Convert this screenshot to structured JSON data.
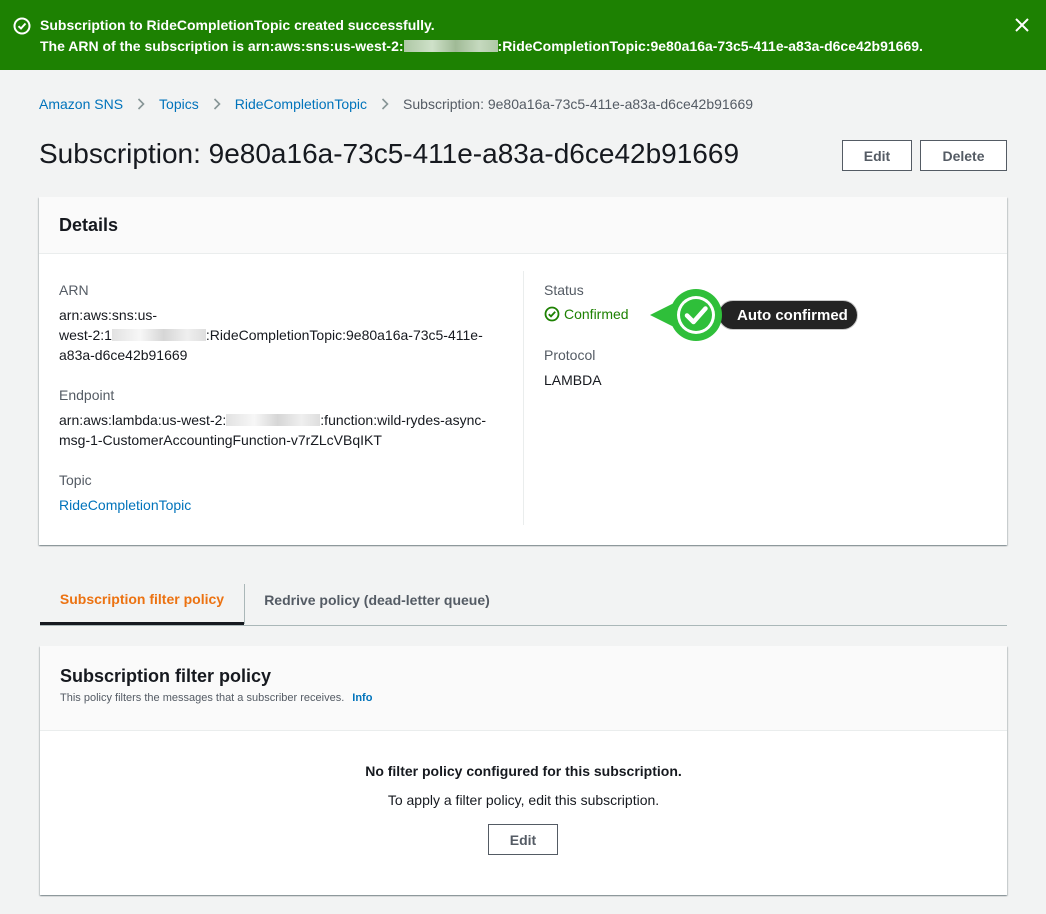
{
  "flash": {
    "line1": "Subscription to RideCompletionTopic created successfully.",
    "line2_prefix": "The ARN of the subscription is arn:aws:sns:us-west-2:",
    "line2_suffix": ":RideCompletionTopic:9e80a16a-73c5-411e-a83a-d6ce42b91669."
  },
  "breadcrumb": {
    "items": [
      "Amazon SNS",
      "Topics",
      "RideCompletionTopic"
    ],
    "current": "Subscription: 9e80a16a-73c5-411e-a83a-d6ce42b91669"
  },
  "page": {
    "title": "Subscription: 9e80a16a-73c5-411e-a83a-d6ce42b91669",
    "edit_label": "Edit",
    "delete_label": "Delete"
  },
  "details": {
    "title": "Details",
    "arn_label": "ARN",
    "arn_line1": "arn:aws:sns:us-",
    "arn_line2_prefix": "west-2:1",
    "arn_line2_suffix": ":RideCompletionTopic:9e80a16a-73c5-411e-",
    "arn_line3": "a83a-d6ce42b91669",
    "endpoint_label": "Endpoint",
    "endpoint_line1_prefix": "arn:aws:lambda:us-west-2:",
    "endpoint_line1_suffix": ":function:wild-rydes-async-",
    "endpoint_line2": "msg-1-CustomerAccountingFunction-v7rZLcVBqIKT",
    "topic_label": "Topic",
    "topic_value": "RideCompletionTopic",
    "status_label": "Status",
    "status_value": "Confirmed",
    "protocol_label": "Protocol",
    "protocol_value": "LAMBDA"
  },
  "callout": {
    "text": "Auto confirmed"
  },
  "tabs": [
    {
      "label": "Subscription filter policy"
    },
    {
      "label": "Redrive policy (dead-letter queue)"
    }
  ],
  "filter": {
    "title": "Subscription filter policy",
    "description": "This policy filters the messages that a subscriber receives.",
    "info_label": "Info",
    "empty_title": "No filter policy configured for this subscription.",
    "empty_desc": "To apply a filter policy, edit this subscription.",
    "edit_label": "Edit"
  },
  "colors": {
    "success": "#1d8102",
    "link": "#0073bb",
    "tab_active": "#ec7211"
  }
}
